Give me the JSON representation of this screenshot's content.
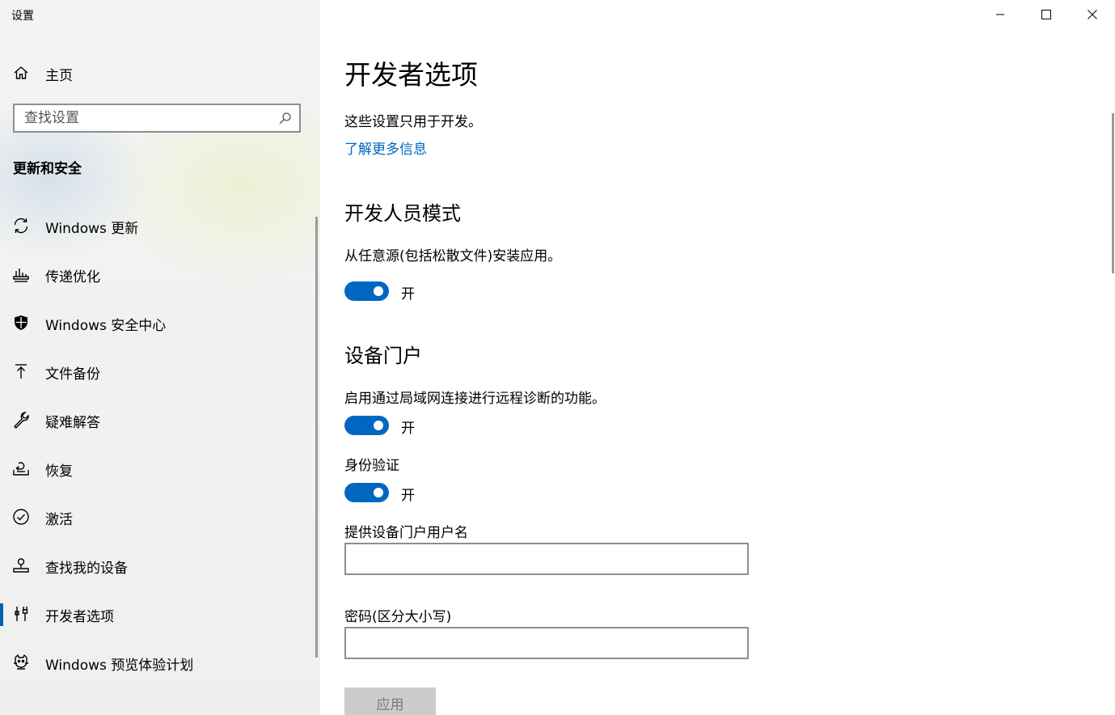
{
  "window": {
    "title": "设置"
  },
  "sidebar": {
    "home_label": "主页",
    "search": {
      "placeholder": "查找设置",
      "value": ""
    },
    "section_title": "更新和安全",
    "items": [
      {
        "label": "Windows 更新",
        "icon": "refresh-icon",
        "selected": false
      },
      {
        "label": "传递优化",
        "icon": "delivery-optimization-icon",
        "selected": false
      },
      {
        "label": "Windows 安全中心",
        "icon": "shield-icon",
        "selected": false
      },
      {
        "label": "文件备份",
        "icon": "backup-arrow-icon",
        "selected": false
      },
      {
        "label": "疑难解答",
        "icon": "wrench-icon",
        "selected": false
      },
      {
        "label": "恢复",
        "icon": "recovery-icon",
        "selected": false
      },
      {
        "label": "激活",
        "icon": "check-circle-icon",
        "selected": false
      },
      {
        "label": "查找我的设备",
        "icon": "find-device-icon",
        "selected": false
      },
      {
        "label": "开发者选项",
        "icon": "developer-tools-icon",
        "selected": true
      },
      {
        "label": "Windows 预览体验计划",
        "icon": "insider-cat-icon",
        "selected": false
      }
    ]
  },
  "main": {
    "title": "开发者选项",
    "description": "这些设置只用于开发。",
    "learn_more": "了解更多信息",
    "developer_mode": {
      "heading": "开发人员模式",
      "description": "从任意源(包括松散文件)安装应用。",
      "toggle_on": true,
      "toggle_label": "开"
    },
    "device_portal": {
      "heading": "设备门户",
      "description": "启用通过局域网连接进行远程诊断的功能。",
      "toggle_on": true,
      "toggle_label": "开",
      "auth_label": "身份验证",
      "auth_toggle_on": true,
      "auth_toggle_label": "开",
      "username_label": "提供设备门户用户名",
      "username_value": "",
      "password_label": "密码(区分大小写)",
      "password_value": ""
    },
    "apply_label": "应用"
  },
  "colors": {
    "accent": "#0067c0",
    "link": "#0067c0",
    "disabled_button": "#cccccc"
  }
}
